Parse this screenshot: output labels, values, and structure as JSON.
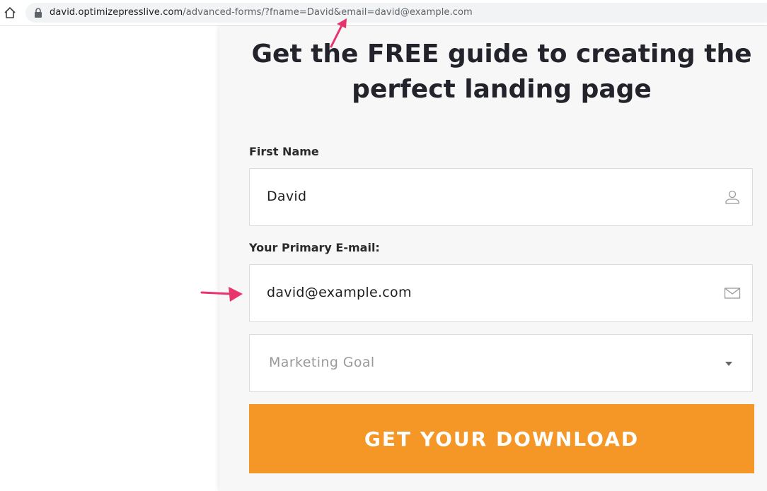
{
  "browser": {
    "url_host": "david.optimizepresslive.com",
    "url_path": "/advanced-forms/?fname=David&email=david@example.com",
    "star_glyph": "☆"
  },
  "page": {
    "headline": "Get the FREE guide to creating the perfect landing page",
    "first_name": {
      "label": "First Name",
      "value": "David"
    },
    "email": {
      "label": "Your Primary E-mail:",
      "value": "david@example.com"
    },
    "marketing_goal": {
      "placeholder": "Marketing Goal"
    },
    "cta_label": "GET YOUR DOWNLOAD"
  },
  "colors": {
    "cta_background": "#f49726",
    "annotation_arrow": "#e8336d",
    "headline": "#23232b"
  }
}
